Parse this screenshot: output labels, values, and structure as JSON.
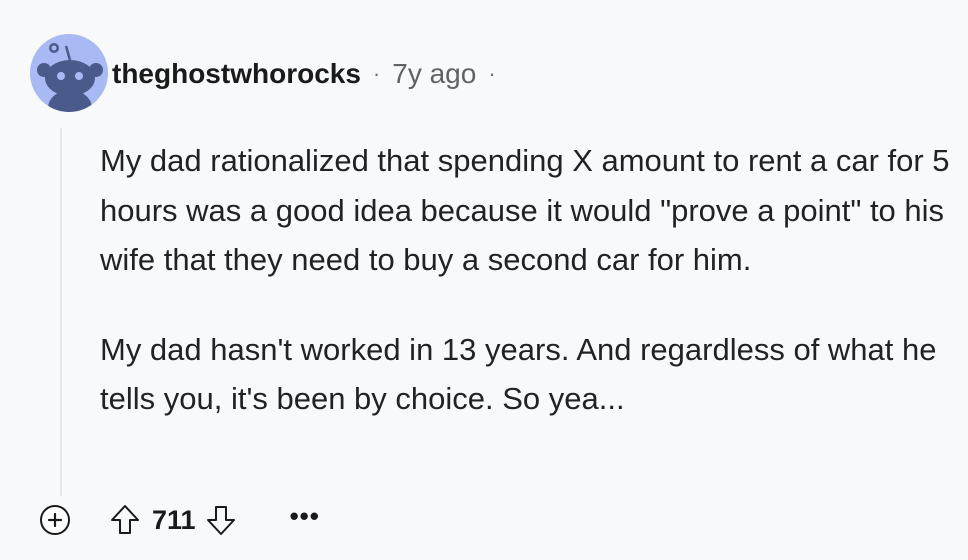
{
  "comment": {
    "username": "theghostwhorocks",
    "separator": "·",
    "age": "7y ago",
    "paragraphs": [
      "My dad rationalized that spending X amount to rent a car for 5 hours was a good idea because it would \"prove a point\" to his wife that they need to buy a second car for him.",
      "My dad hasn't worked in 13 years. And regardless of what he tells you, it's been by choice. So yea..."
    ],
    "score": "711",
    "more_label": "•••"
  },
  "icons": {
    "avatar": "reddit-snoo-avatar",
    "expand": "plus-circle-icon",
    "upvote": "up-arrow-outline-icon",
    "downvote": "down-arrow-outline-icon",
    "more": "ellipsis-icon"
  },
  "colors": {
    "background": "#f8f9fa",
    "avatar_bg": "#a9b9f3",
    "text": "#1a1a1b",
    "meta": "#5f6367"
  }
}
